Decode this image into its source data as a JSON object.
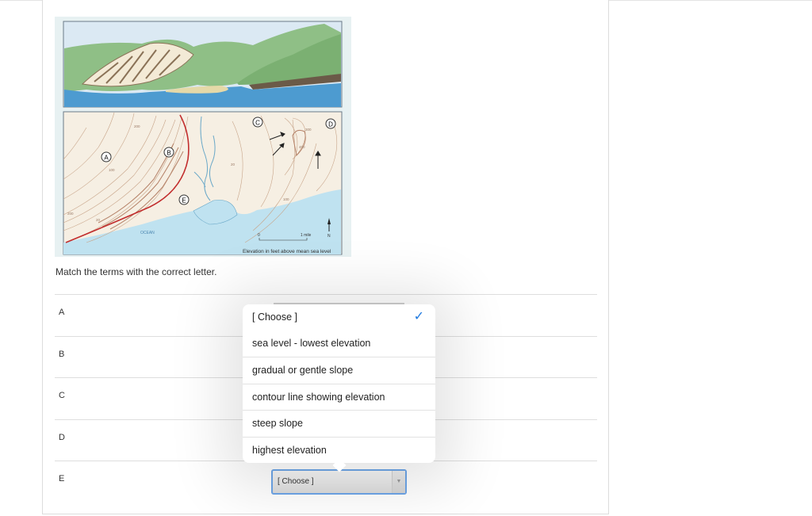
{
  "question": {
    "prompt": "Match the terms with the correct letter.",
    "figure": {
      "labels": [
        "A",
        "B",
        "C",
        "D",
        "E"
      ],
      "ocean_label": "OCEAN",
      "scale_zero": "0",
      "scale_label": "1 mile",
      "north_label": "N",
      "caption": "Elevation in feet above mean sea level",
      "contour_labels": [
        "200",
        "100",
        "20",
        "200",
        "20",
        "300",
        "400",
        "100"
      ]
    },
    "rows": [
      {
        "letter": "A"
      },
      {
        "letter": "B"
      },
      {
        "letter": "C"
      },
      {
        "letter": "D"
      },
      {
        "letter": "E",
        "selected": "[ Choose ]"
      }
    ]
  },
  "dropdown": {
    "options": [
      {
        "label": "[ Choose ]",
        "selected": true
      },
      {
        "label": "sea level - lowest elevation",
        "selected": false
      },
      {
        "label": "gradual or gentle slope",
        "selected": false
      },
      {
        "label": "contour line showing elevation",
        "selected": false
      },
      {
        "label": "steep slope",
        "selected": false
      },
      {
        "label": "highest elevation",
        "selected": false
      }
    ],
    "check_icon": "checkmark-icon",
    "accent_color": "#1f7ae0"
  }
}
